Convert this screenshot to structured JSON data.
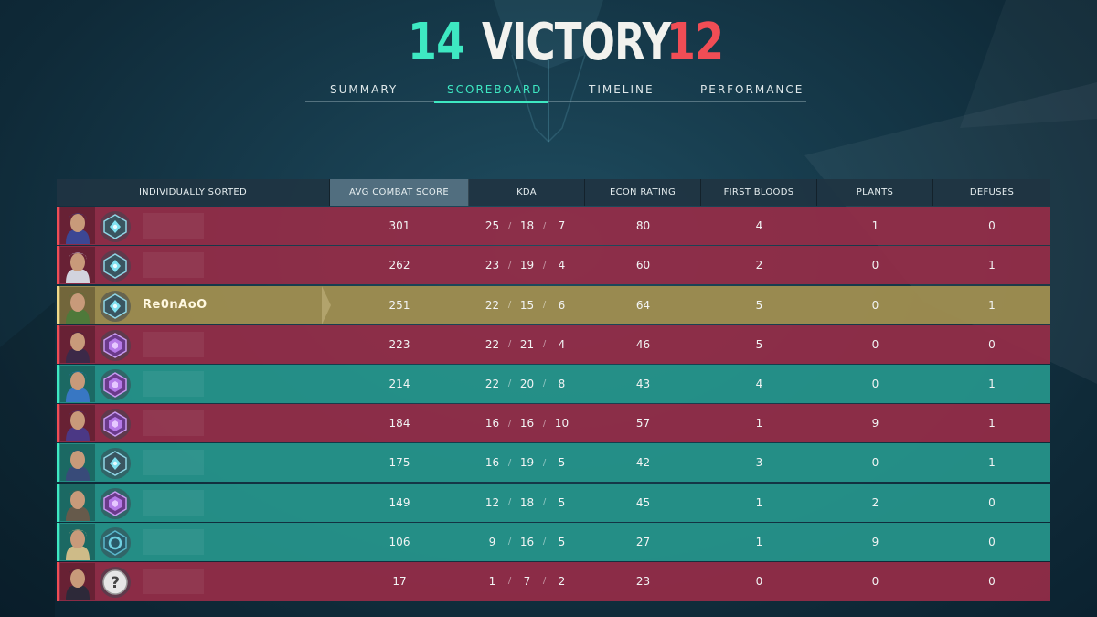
{
  "header": {
    "ally_score": "14",
    "result": "VICTORY",
    "enemy_score": "12"
  },
  "tabs": [
    {
      "label": "SUMMARY",
      "active": false
    },
    {
      "label": "SCOREBOARD",
      "active": true
    },
    {
      "label": "TIMELINE",
      "active": false
    },
    {
      "label": "PERFORMANCE",
      "active": false
    }
  ],
  "table": {
    "columns": [
      "INDIVIDUALLY SORTED",
      "AVG COMBAT SCORE",
      "KDA",
      "ECON RATING",
      "FIRST BLOODS",
      "PLANTS",
      "DEFUSES"
    ],
    "sorted_column": "AVG COMBAT SCORE",
    "rows": [
      {
        "team": "enemy",
        "name": "",
        "rank_icon": "diamond-rank-icon",
        "acs": "301",
        "k": "25",
        "d": "18",
        "a": "7",
        "econ": "80",
        "fb": "4",
        "plants": "1",
        "defuses": "0"
      },
      {
        "team": "enemy",
        "name": "",
        "rank_icon": "diamond-rank-icon",
        "acs": "262",
        "k": "23",
        "d": "19",
        "a": "4",
        "econ": "60",
        "fb": "2",
        "plants": "0",
        "defuses": "1"
      },
      {
        "team": "self",
        "name": "Re0nAoO",
        "rank_icon": "diamond-rank-icon",
        "acs": "251",
        "k": "22",
        "d": "15",
        "a": "6",
        "econ": "64",
        "fb": "5",
        "plants": "0",
        "defuses": "1"
      },
      {
        "team": "enemy",
        "name": "",
        "rank_icon": "immortal-rank-icon",
        "acs": "223",
        "k": "22",
        "d": "21",
        "a": "4",
        "econ": "46",
        "fb": "5",
        "plants": "0",
        "defuses": "0"
      },
      {
        "team": "ally",
        "name": "",
        "rank_icon": "immortal-rank-icon",
        "acs": "214",
        "k": "22",
        "d": "20",
        "a": "8",
        "econ": "43",
        "fb": "4",
        "plants": "0",
        "defuses": "1"
      },
      {
        "team": "enemy",
        "name": "",
        "rank_icon": "immortal-rank-icon",
        "acs": "184",
        "k": "16",
        "d": "16",
        "a": "10",
        "econ": "57",
        "fb": "1",
        "plants": "9",
        "defuses": "1"
      },
      {
        "team": "ally",
        "name": "",
        "rank_icon": "diamond-rank-icon",
        "acs": "175",
        "k": "16",
        "d": "19",
        "a": "5",
        "econ": "42",
        "fb": "3",
        "plants": "0",
        "defuses": "1"
      },
      {
        "team": "ally",
        "name": "",
        "rank_icon": "immortal-rank-icon",
        "acs": "149",
        "k": "12",
        "d": "18",
        "a": "5",
        "econ": "45",
        "fb": "1",
        "plants": "2",
        "defuses": "0"
      },
      {
        "team": "ally",
        "name": "",
        "rank_icon": "platinum-rank-icon",
        "acs": "106",
        "k": "9",
        "d": "16",
        "a": "5",
        "econ": "27",
        "fb": "1",
        "plants": "9",
        "defuses": "0"
      },
      {
        "team": "enemy",
        "name": "",
        "rank_icon": "unranked-icon",
        "acs": "17",
        "k": "1",
        "d": "7",
        "a": "2",
        "econ": "23",
        "fb": "0",
        "plants": "0",
        "defuses": "0"
      }
    ]
  },
  "colors": {
    "ally": "#3ee8c2",
    "enemy": "#f04d55",
    "self": "#f0d98a",
    "ally_row": "#26968c",
    "enemy_row": "#962c48",
    "self_row": "#a08e50"
  },
  "agent_colors": [
    "#3a4a9a",
    "#d8dde8",
    "#4c7a3a",
    "#3a2a4a",
    "#3a78c8",
    "#4a3a8a",
    "#3a4a7a",
    "#6a5a4a",
    "#d8c08a",
    "#2a2a3a"
  ]
}
